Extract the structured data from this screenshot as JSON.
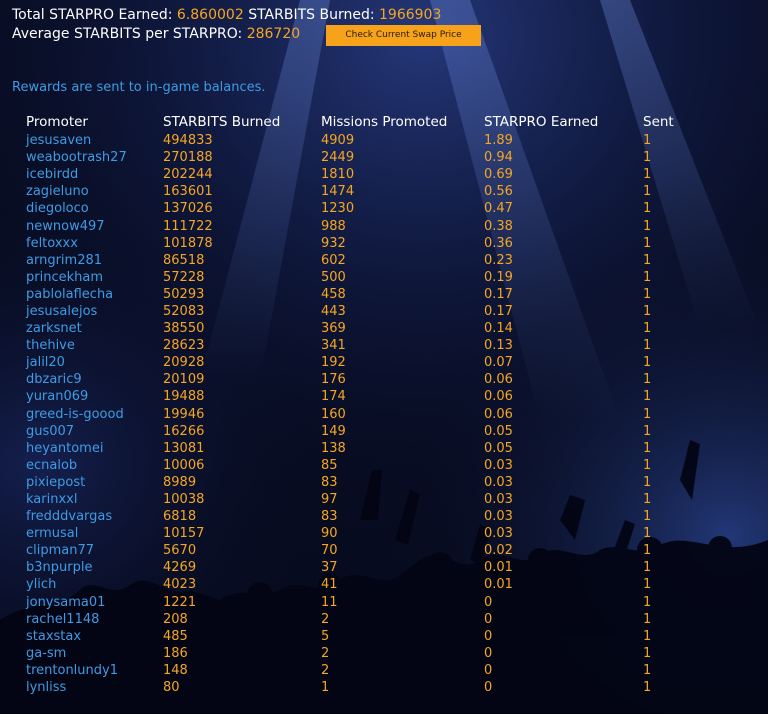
{
  "summary": {
    "total_label": "Total STARPRO Earned:",
    "total_value": "6.860002",
    "burned_label": "STARBITS Burned:",
    "burned_value": "1966903",
    "average_label": "Average STARBITS per STARPRO:",
    "average_value": "286720",
    "swap_button_label": "Check Current Swap Price"
  },
  "notice": "Rewards are sent to in-game balances.",
  "colors": {
    "accent_orange": "#f5a623",
    "link_blue": "#3f9be3",
    "background_navy": "#070b1f"
  },
  "table": {
    "headers": [
      "Promoter",
      "STARBITS Burned",
      "Missions Promoted",
      "STARPRO Earned",
      "Sent"
    ],
    "rows": [
      [
        "jesusaven",
        "494833",
        "4909",
        "1.89",
        "1"
      ],
      [
        "weabootrash27",
        "270188",
        "2449",
        "0.94",
        "1"
      ],
      [
        "icebirdd",
        "202244",
        "1810",
        "0.69",
        "1"
      ],
      [
        "zagieluno",
        "163601",
        "1474",
        "0.56",
        "1"
      ],
      [
        "diegoloco",
        "137026",
        "1230",
        "0.47",
        "1"
      ],
      [
        "newnow497",
        "111722",
        "988",
        "0.38",
        "1"
      ],
      [
        "feltoxxx",
        "101878",
        "932",
        "0.36",
        "1"
      ],
      [
        "arngrim281",
        "86518",
        "602",
        "0.23",
        "1"
      ],
      [
        "princekham",
        "57228",
        "500",
        "0.19",
        "1"
      ],
      [
        "pablolaflecha",
        "50293",
        "458",
        "0.17",
        "1"
      ],
      [
        "jesusalejos",
        "52083",
        "443",
        "0.17",
        "1"
      ],
      [
        "zarksnet",
        "38550",
        "369",
        "0.14",
        "1"
      ],
      [
        "thehive",
        "28623",
        "341",
        "0.13",
        "1"
      ],
      [
        "jalil20",
        "20928",
        "192",
        "0.07",
        "1"
      ],
      [
        "dbzaric9",
        "20109",
        "176",
        "0.06",
        "1"
      ],
      [
        "yuran069",
        "19488",
        "174",
        "0.06",
        "1"
      ],
      [
        "greed-is-goood",
        "19946",
        "160",
        "0.06",
        "1"
      ],
      [
        "gus007",
        "16266",
        "149",
        "0.05",
        "1"
      ],
      [
        "heyantomei",
        "13081",
        "138",
        "0.05",
        "1"
      ],
      [
        "ecnalob",
        "10006",
        "85",
        "0.03",
        "1"
      ],
      [
        "pixiepost",
        "8989",
        "83",
        "0.03",
        "1"
      ],
      [
        "karinxxl",
        "10038",
        "97",
        "0.03",
        "1"
      ],
      [
        "fredddvargas",
        "6818",
        "83",
        "0.03",
        "1"
      ],
      [
        "ermusal",
        "10157",
        "90",
        "0.03",
        "1"
      ],
      [
        "clipman77",
        "5670",
        "70",
        "0.02",
        "1"
      ],
      [
        "b3npurple",
        "4269",
        "37",
        "0.01",
        "1"
      ],
      [
        "ylich",
        "4023",
        "41",
        "0.01",
        "1"
      ],
      [
        "jonysama01",
        "1221",
        "11",
        "0",
        "1"
      ],
      [
        "rachel1148",
        "208",
        "2",
        "0",
        "1"
      ],
      [
        "staxstax",
        "485",
        "5",
        "0",
        "1"
      ],
      [
        "ga-sm",
        "186",
        "2",
        "0",
        "1"
      ],
      [
        "trentonlundy1",
        "148",
        "2",
        "0",
        "1"
      ],
      [
        "lynliss",
        "80",
        "1",
        "0",
        "1"
      ]
    ]
  }
}
